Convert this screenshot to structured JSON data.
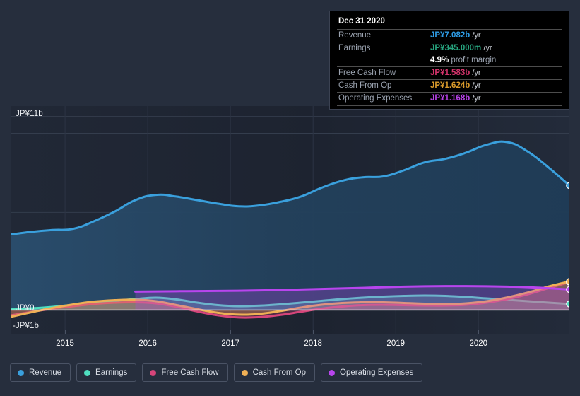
{
  "tooltip": {
    "title": "Dec 31 2020",
    "rows": [
      {
        "label": "Revenue",
        "value": "JP¥7.082b",
        "unit": "/yr",
        "color": "#2e9ce5"
      },
      {
        "label": "Earnings",
        "value": "JP¥345.000m",
        "unit": "/yr",
        "color": "#27a57f"
      },
      {
        "label": "",
        "value": "4.9%",
        "unit": "profit margin",
        "color": "#ffffff",
        "margin_row": true
      },
      {
        "label": "Free Cash Flow",
        "value": "JP¥1.583b",
        "unit": "/yr",
        "color": "#d6336c"
      },
      {
        "label": "Cash From Op",
        "value": "JP¥1.624b",
        "unit": "/yr",
        "color": "#d99a2b"
      },
      {
        "label": "Operating Expenses",
        "value": "JP¥1.168b",
        "unit": "/yr",
        "color": "#b843e8"
      }
    ]
  },
  "legend": {
    "items": [
      {
        "label": "Revenue",
        "color": "#3aa0dd"
      },
      {
        "label": "Earnings",
        "color": "#4fdfc0"
      },
      {
        "label": "Free Cash Flow",
        "color": "#d6457a"
      },
      {
        "label": "Cash From Op",
        "color": "#efb055"
      },
      {
        "label": "Operating Expenses",
        "color": "#b845ee"
      }
    ]
  },
  "axes": {
    "y_labels": {
      "top": "JP¥11b",
      "zero": "JP¥0",
      "negative": "-JP¥1b"
    },
    "x_labels": [
      "2015",
      "2016",
      "2017",
      "2018",
      "2019",
      "2020"
    ]
  },
  "chart_data": {
    "type": "area",
    "title": "",
    "xlabel": "",
    "ylabel": "JP¥",
    "ylim": [
      -1,
      11
    ],
    "y_ticks": [
      11,
      0,
      -1
    ],
    "grid": true,
    "legend_position": "bottom",
    "currency": "JP¥",
    "unit": "billions",
    "x": [
      2014.35,
      2014.6,
      2014.85,
      2015.1,
      2015.35,
      2015.6,
      2015.85,
      2016.1,
      2016.35,
      2016.6,
      2016.85,
      2017.1,
      2017.35,
      2017.6,
      2017.85,
      2018.1,
      2018.35,
      2018.6,
      2018.85,
      2019.1,
      2019.35,
      2019.6,
      2019.85,
      2020.1,
      2020.35,
      2020.6,
      2020.85,
      2021.1
    ],
    "x_tick_labels": [
      "2015",
      "2016",
      "2017",
      "2018",
      "2019",
      "2020"
    ],
    "series": [
      {
        "name": "Revenue",
        "color": "#3aa0dd",
        "fill": true,
        "end_value": 7.082,
        "values": [
          4.3,
          4.45,
          4.55,
          4.62,
          5.05,
          5.6,
          6.25,
          6.55,
          6.45,
          6.25,
          6.05,
          5.9,
          5.95,
          6.15,
          6.45,
          6.95,
          7.35,
          7.55,
          7.6,
          7.95,
          8.4,
          8.6,
          8.95,
          9.4,
          9.55,
          9.0,
          8.1,
          7.082
        ]
      },
      {
        "name": "Earnings",
        "color": "#4fdfc0",
        "fill": true,
        "end_value": 0.345,
        "values": [
          0.05,
          0.1,
          0.18,
          0.3,
          0.42,
          0.52,
          0.62,
          0.7,
          0.6,
          0.42,
          0.28,
          0.22,
          0.25,
          0.32,
          0.42,
          0.52,
          0.62,
          0.7,
          0.76,
          0.8,
          0.82,
          0.8,
          0.74,
          0.66,
          0.58,
          0.5,
          0.42,
          0.345
        ]
      },
      {
        "name": "Free Cash Flow",
        "color": "#d6457a",
        "fill": true,
        "end_value": 1.583,
        "values": [
          -0.3,
          -0.1,
          0.08,
          0.22,
          0.35,
          0.42,
          0.44,
          0.38,
          0.18,
          -0.08,
          -0.3,
          -0.42,
          -0.4,
          -0.28,
          -0.1,
          0.08,
          0.2,
          0.28,
          0.3,
          0.28,
          0.26,
          0.26,
          0.3,
          0.42,
          0.62,
          0.9,
          1.25,
          1.583
        ]
      },
      {
        "name": "Cash From Op",
        "color": "#efb055",
        "fill": true,
        "end_value": 1.624,
        "values": [
          -0.38,
          -0.12,
          0.12,
          0.32,
          0.48,
          0.56,
          0.58,
          0.5,
          0.28,
          0.05,
          -0.16,
          -0.26,
          -0.22,
          -0.06,
          0.14,
          0.3,
          0.4,
          0.44,
          0.44,
          0.4,
          0.36,
          0.34,
          0.38,
          0.5,
          0.72,
          1.0,
          1.34,
          1.624
        ]
      },
      {
        "name": "Operating Expenses",
        "color": "#b845ee",
        "fill": true,
        "start_x": 2015.85,
        "end_value": 1.168,
        "values": [
          null,
          null,
          null,
          null,
          null,
          null,
          1.05,
          1.06,
          1.07,
          1.08,
          1.09,
          1.1,
          1.12,
          1.14,
          1.17,
          1.2,
          1.23,
          1.26,
          1.3,
          1.33,
          1.35,
          1.36,
          1.36,
          1.35,
          1.33,
          1.3,
          1.24,
          1.168
        ]
      }
    ]
  }
}
